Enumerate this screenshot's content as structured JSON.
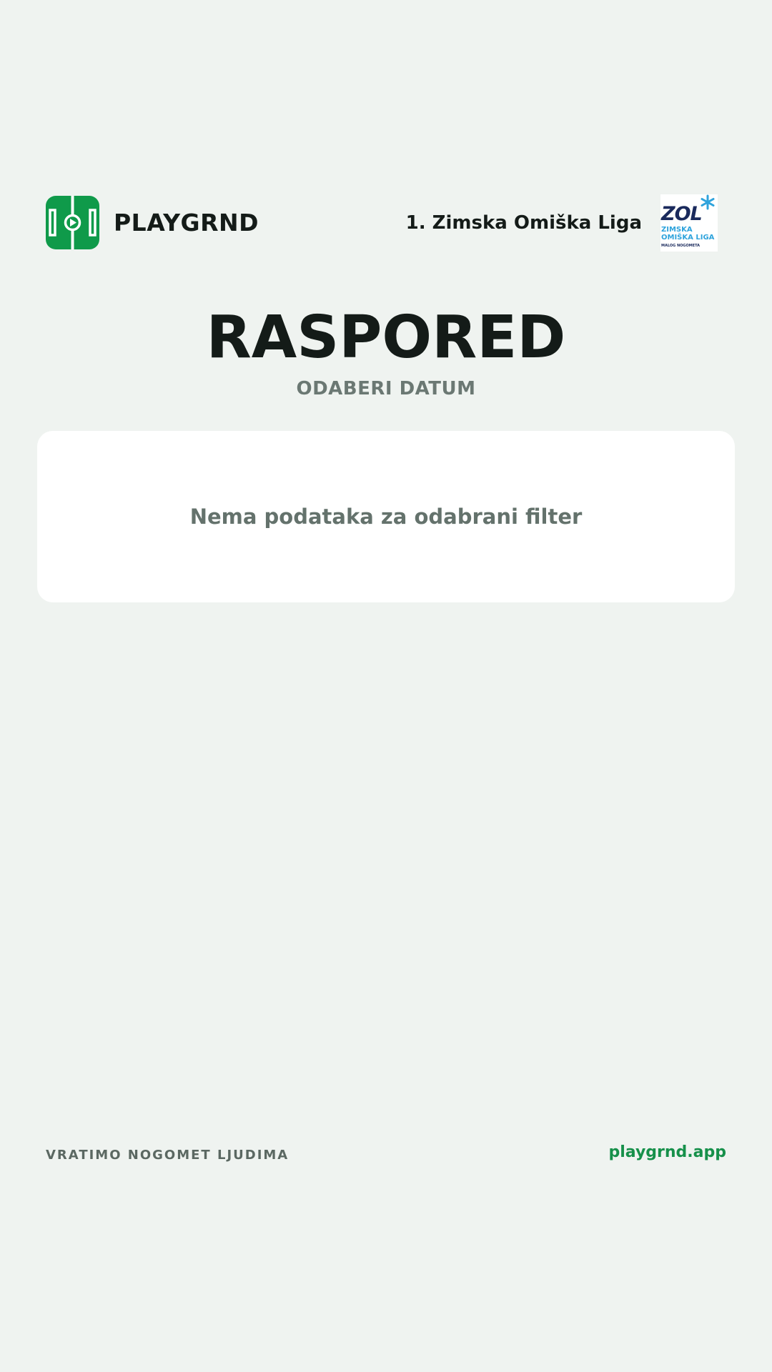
{
  "header": {
    "brand_name": "PLAYGRND",
    "brand_logo_icon": "soccer-field-icon",
    "league_name": "1. Zimska Omiška Liga",
    "league_logo": {
      "main": "ZOL",
      "line1": "ZIMSKA",
      "line2": "OMIŠKA LIGA",
      "line3": "MALOG NOGOMETA"
    }
  },
  "main": {
    "title": "RASPORED",
    "subtitle": "ODABERI DATUM",
    "empty_message": "Nema podataka za odabrani filter"
  },
  "footer": {
    "tagline": "VRATIMO NOGOMET LJUDIMA",
    "link": "playgrnd.app"
  },
  "colors": {
    "background": "#eff3f0",
    "brand_green": "#0f9a4a",
    "link_green": "#16904a",
    "title": "#141b18",
    "muted": "#6b7873",
    "league_navy": "#1a2a5c",
    "league_blue": "#2ea3dc"
  }
}
